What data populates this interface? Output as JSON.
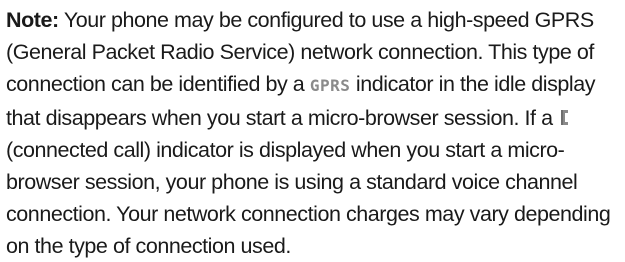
{
  "note": {
    "label": "Note:",
    "text_1": " Your phone may be configured to use a high-speed GPRS (General Packet Radio Service) network connection. This type of connection can be identified by a ",
    "indicator_gprs": "GPRS",
    "text_2": " indicator in the idle display that disappears when you start a micro-browser session. If a ",
    "indicator_call_icon": "connected-call-icon",
    "text_3": " (connected call) indicator is displayed when you start a micro-browser session, your phone is using a standard voice channel connection. Your network connection charges may vary depending on the type of connection used."
  }
}
